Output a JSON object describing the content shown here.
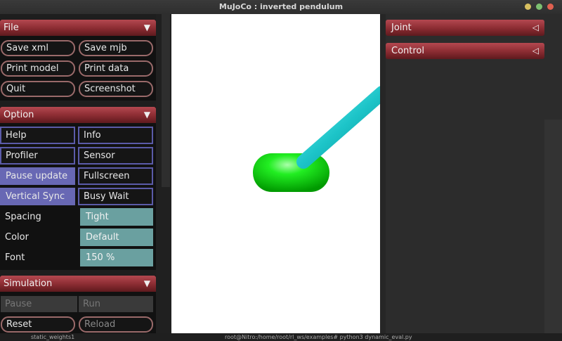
{
  "window": {
    "title": "MuJoCo : inverted pendulum"
  },
  "file": {
    "header": "File",
    "buttons": [
      "Save xml",
      "Save mjb",
      "Print model",
      "Print data",
      "Quit",
      "Screenshot"
    ]
  },
  "option": {
    "header": "Option",
    "checks": [
      {
        "label": "Help",
        "on": false
      },
      {
        "label": "Info",
        "on": false
      },
      {
        "label": "Profiler",
        "on": false
      },
      {
        "label": "Sensor",
        "on": false
      },
      {
        "label": "Pause update",
        "on": true
      },
      {
        "label": "Fullscreen",
        "on": false
      },
      {
        "label": "Vertical Sync",
        "on": true
      },
      {
        "label": "Busy Wait",
        "on": false
      }
    ],
    "spacing_label": "Spacing",
    "spacing_value": "Tight",
    "color_label": "Color",
    "color_value": "Default",
    "font_label": "Font",
    "font_value": "150 %"
  },
  "simulation": {
    "header": "Simulation",
    "pause": "Pause",
    "run": "Run",
    "reset": "Reset",
    "reload": "Reload"
  },
  "right": {
    "joint": "Joint",
    "control": "Control"
  },
  "terminal": {
    "left_text": "static_weights1",
    "line": "root@Nitro:/home/root/rl_ws/examples# python3 dynamic_eval.py"
  },
  "colors": {
    "header": "#8a2b31",
    "check_on": "#6868b4",
    "select": "#6aa0a0",
    "cart": "#00ee00",
    "pole": "#22c8cc"
  }
}
